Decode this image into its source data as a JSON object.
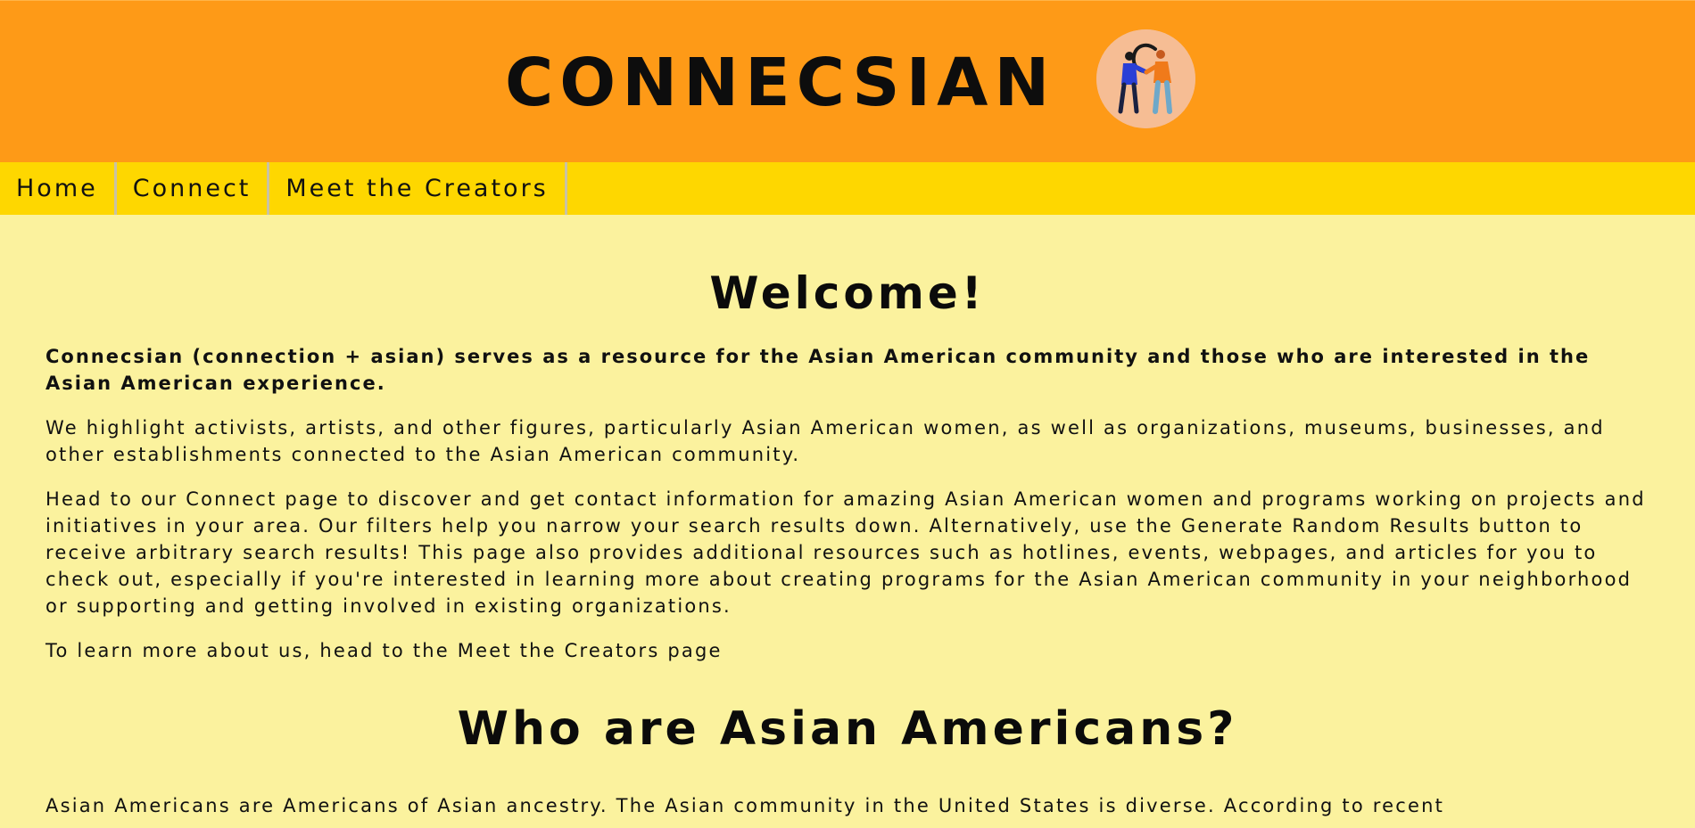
{
  "header": {
    "brand": "CONNECSIAN",
    "logo_icon": "connecsian-logo-icon",
    "background": "#fe9a17"
  },
  "nav": {
    "items": [
      {
        "label": "Home"
      },
      {
        "label": "Connect"
      },
      {
        "label": "Meet the Creators"
      }
    ],
    "background": "#fed700"
  },
  "main": {
    "welcome_heading": "Welcome!",
    "paragraphs": [
      "Connecsian (connection + asian) serves as a resource for the Asian American community and those who are interested in the Asian American experience.",
      "We highlight activists, artists, and other figures, particularly Asian American women, as well as organizations, museums, businesses, and other establishments connected to the Asian American community.",
      "Head to our Connect page to discover and get contact information for amazing Asian American women and programs working on projects and initiatives in your area. Our filters help you narrow your search results down. Alternatively, use the Generate Random Results button to receive arbitrary search results! This page also provides additional resources such as hotlines, events, webpages, and articles for you to check out, especially if you're interested in learning more about creating programs for the Asian American community in your neighborhood or supporting and getting involved in existing organizations.",
      "To learn more about us, head to the Meet the Creators page"
    ],
    "who_heading": "Who are Asian Americans?",
    "who_paragraph": "Asian Americans are Americans of Asian ancestry. The Asian community in the United States is diverse. According to recent",
    "background": "#fbf29e"
  }
}
